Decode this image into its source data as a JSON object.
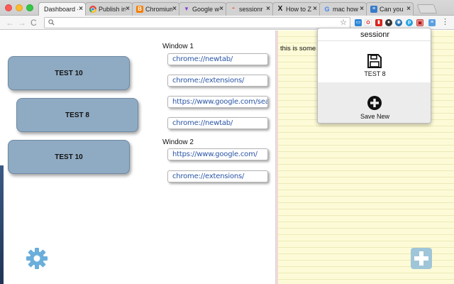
{
  "tabs": [
    {
      "label": "Dashboard - ",
      "active": true,
      "icon": "none"
    },
    {
      "label": "Publish in",
      "active": false,
      "icon": "chrome-icon"
    },
    {
      "label": "Chromium",
      "active": false,
      "icon": "blogger-icon"
    },
    {
      "label": "Google w",
      "active": false,
      "icon": "v-icon"
    },
    {
      "label": "sessionr",
      "active": false,
      "icon": "reddit-icon"
    },
    {
      "label": "How to Z",
      "active": false,
      "icon": "x-icon"
    },
    {
      "label": "mac how",
      "active": false,
      "icon": "google-icon"
    },
    {
      "label": "Can you",
      "active": false,
      "icon": "stackexchange-icon"
    }
  ],
  "toolbar": {
    "address_value": ""
  },
  "sessions": [
    {
      "label": "TEST 10"
    },
    {
      "label": "TEST 8"
    },
    {
      "label": "TEST 10"
    }
  ],
  "windows": [
    {
      "label": "Window 1",
      "urls": [
        "chrome://newtab/",
        "chrome://extensions/",
        "https://www.google.com/sea",
        "chrome://newtab/"
      ]
    },
    {
      "label": "Window 2",
      "urls": [
        "https://www.google.com/",
        "chrome://extensions/"
      ]
    }
  ],
  "notes": {
    "text": "this is some"
  },
  "popup": {
    "title": "sessionr",
    "save_label": "TEST 8",
    "new_label": "Save New"
  },
  "colors": {
    "session_button": "#8fabc3",
    "url_text": "#2a55a5",
    "notes_bg": "#fdfbd7",
    "add_button": "#9fc5d9",
    "gear": "#6aaedb"
  }
}
